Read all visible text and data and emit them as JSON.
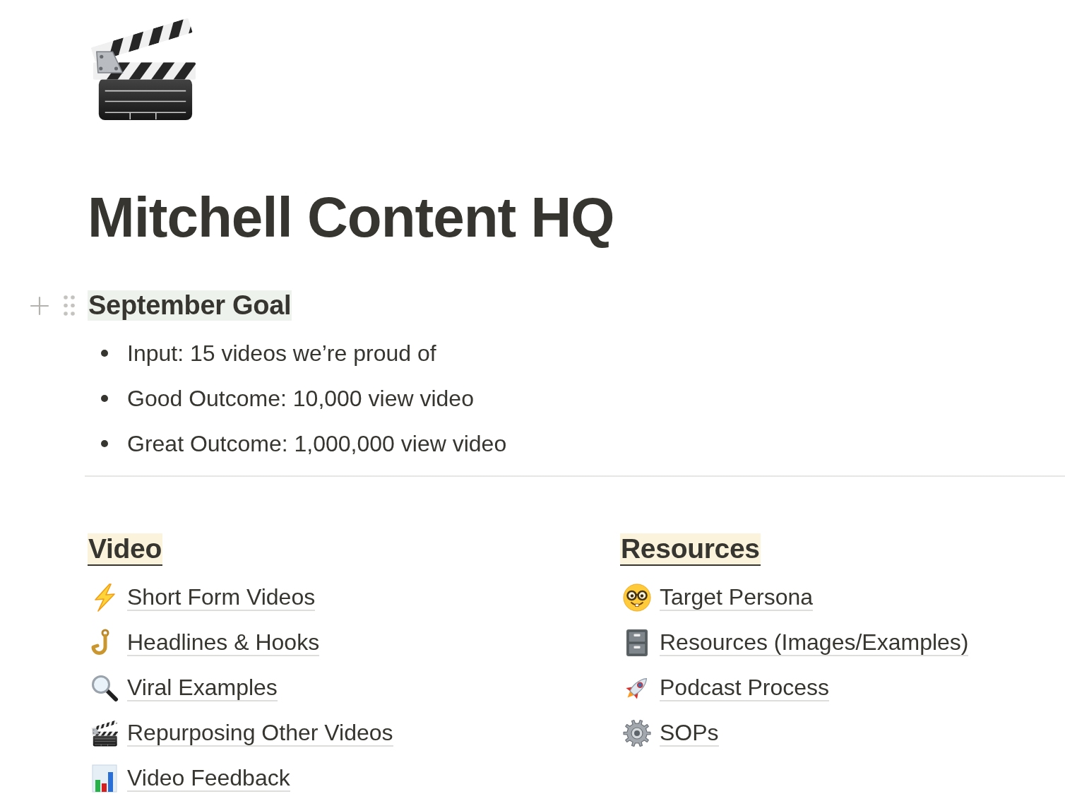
{
  "page": {
    "title": "Mitchell Content HQ"
  },
  "goal": {
    "heading": "September Goal",
    "bullets": [
      "Input: 15 videos we’re proud of",
      "Good Outcome: 10,000 view video",
      "Great Outcome: 1,000,000 view video"
    ]
  },
  "columns": [
    {
      "heading": "Video",
      "links": [
        "Short Form Videos",
        "Headlines & Hooks",
        "Viral Examples",
        "Repurposing Other Videos",
        "Video Feedback"
      ]
    },
    {
      "heading": "Resources",
      "links": [
        "Target Persona",
        "Resources (Images/Examples)",
        "Podcast Process",
        "SOPs"
      ]
    }
  ]
}
